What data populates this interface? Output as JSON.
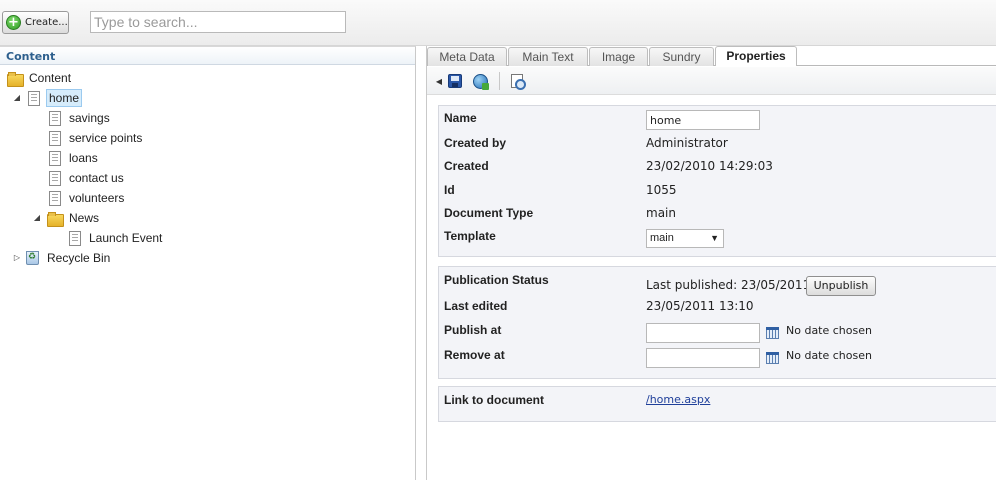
{
  "toolbar": {
    "create_label": "Create...",
    "search_placeholder": "Type to search..."
  },
  "left_panel": {
    "header": "Content",
    "tree": [
      {
        "label": "Content",
        "icon": "folder-icon"
      },
      {
        "label": "home",
        "icon": "document-icon",
        "selected": true
      },
      {
        "label": "savings",
        "icon": "document-icon"
      },
      {
        "label": "service points",
        "icon": "document-icon"
      },
      {
        "label": "loans",
        "icon": "document-icon"
      },
      {
        "label": "contact us",
        "icon": "document-icon"
      },
      {
        "label": "volunteers",
        "icon": "document-icon"
      },
      {
        "label": "News",
        "icon": "folder-icon"
      },
      {
        "label": "Launch Event",
        "icon": "document-icon"
      },
      {
        "label": "Recycle Bin",
        "icon": "recycle-bin-icon"
      }
    ]
  },
  "tabs": [
    "Meta Data",
    "Main Text",
    "Image",
    "Sundry",
    "Properties"
  ],
  "active_tab": "Properties",
  "properties": {
    "name_label": "Name",
    "name_value": "home",
    "created_by_label": "Created by",
    "created_by_value": "Administrator",
    "created_label": "Created",
    "created_value": "23/02/2010 14:29:03",
    "id_label": "Id",
    "id_value": "1055",
    "doctype_label": "Document Type",
    "doctype_value": "main",
    "template_label": "Template",
    "template_value": "main"
  },
  "publication": {
    "status_label": "Publication Status",
    "status_value": "Last published: 23/05/2011",
    "unpublish_label": "Unpublish",
    "last_edited_label": "Last edited",
    "last_edited_value": "23/05/2011 13:10",
    "publish_at_label": "Publish at",
    "publish_at_value": "",
    "publish_at_note": "No date chosen",
    "remove_at_label": "Remove at",
    "remove_at_value": "",
    "remove_at_note": "No date chosen"
  },
  "link": {
    "label": "Link to document",
    "value": "/home.aspx"
  }
}
